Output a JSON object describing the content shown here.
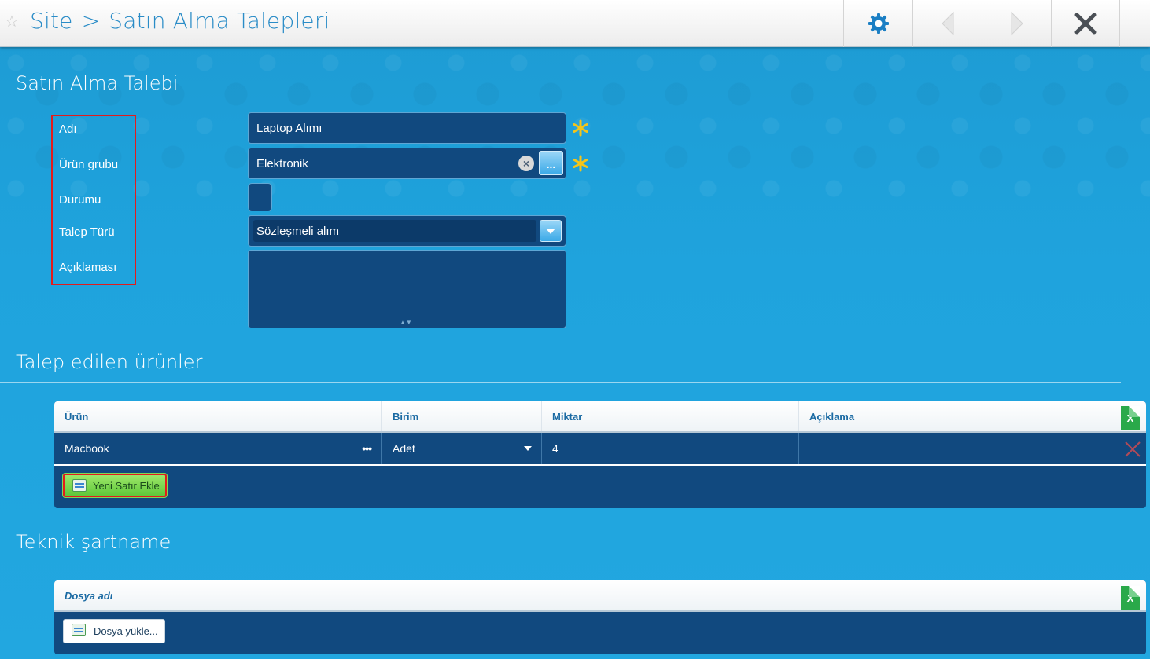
{
  "header": {
    "breadcrumb": [
      "Site",
      ">",
      "Satın Alma Talepleri"
    ],
    "icons": [
      "star-icon",
      "gear-icon",
      "back-arrow-icon",
      "forward-arrow-icon",
      "close-icon"
    ]
  },
  "form": {
    "title": "Satın Alma Talebi",
    "labels": {
      "name": "Adı",
      "product_group": "Ürün grubu",
      "status": "Durumu",
      "request_type": "Talep Türü",
      "description": "Açıklaması"
    },
    "values": {
      "name": "Laptop Alımı",
      "product_group": "Elektronik",
      "status_checked": false,
      "request_type": "Sözleşmeli alım",
      "description": ""
    },
    "lookup_button": "...",
    "clear_button": "×"
  },
  "products": {
    "title": "Talep edilen ürünler",
    "columns": [
      "Ürün",
      "Birim",
      "Miktar",
      "Açıklama"
    ],
    "export_label": "X",
    "rows": [
      {
        "product": "Macbook",
        "product_lookup": "•••",
        "unit": "Adet",
        "quantity": "4",
        "description": ""
      }
    ],
    "add_row_label": "Yeni Satır Ekle"
  },
  "spec": {
    "title": "Teknik şartname",
    "columns": [
      "Dosya adı"
    ],
    "export_label": "X",
    "upload_label": "Dosya yükle..."
  },
  "colors": {
    "background": "#1fa3dd",
    "field_bg": "#11497f",
    "required_star": "#f5c518",
    "highlight_border": "#e41b1b",
    "add_button": "#6fd147",
    "excel": "#2aa94a"
  }
}
